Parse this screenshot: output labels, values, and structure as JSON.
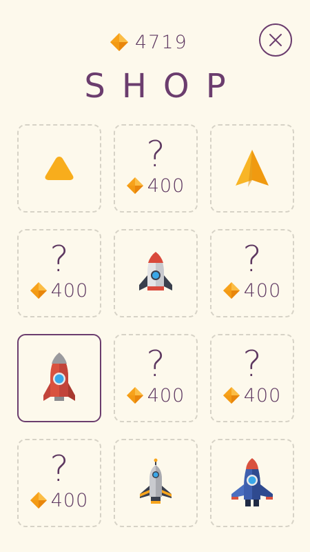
{
  "header": {
    "gems": "4719",
    "gem_icon": "diamond-icon",
    "title": "SHOP",
    "close_icon": "close-icon"
  },
  "colors": {
    "background": "#fdf9ec",
    "accent_purple": "#6b3d6e",
    "gem_orange": "#f7a21b",
    "dashed_border": "#d6d2c6"
  },
  "items": [
    {
      "state": "owned",
      "icon": "triangle-ship-icon"
    },
    {
      "state": "locked",
      "label": "?",
      "price": "400"
    },
    {
      "state": "owned",
      "icon": "paper-plane-icon"
    },
    {
      "state": "locked",
      "label": "?",
      "price": "400"
    },
    {
      "state": "owned",
      "icon": "small-rocket-icon"
    },
    {
      "state": "locked",
      "label": "?",
      "price": "400"
    },
    {
      "state": "selected",
      "icon": "red-rocket-icon"
    },
    {
      "state": "locked",
      "label": "?",
      "price": "400"
    },
    {
      "state": "locked",
      "label": "?",
      "price": "400"
    },
    {
      "state": "locked",
      "label": "?",
      "price": "400"
    },
    {
      "state": "owned",
      "icon": "grey-shuttle-icon"
    },
    {
      "state": "owned",
      "icon": "blue-jet-icon"
    }
  ]
}
